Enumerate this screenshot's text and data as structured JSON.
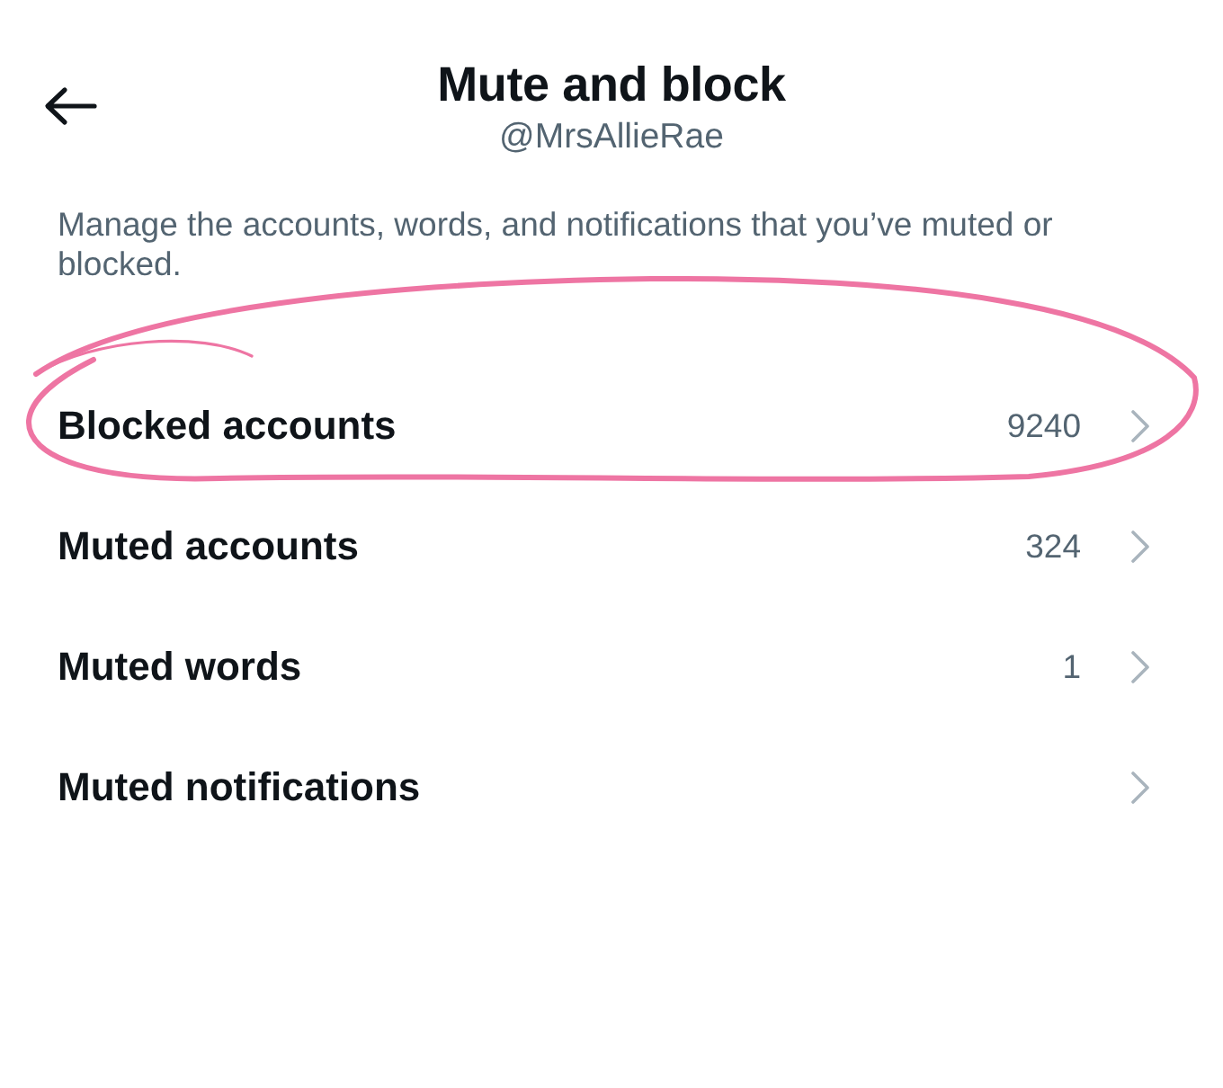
{
  "header": {
    "title": "Mute and block",
    "subtitle": "@MrsAllieRae"
  },
  "description": "Manage the accounts, words, and notifications that you’ve muted or blocked.",
  "rows": [
    {
      "label": "Blocked accounts",
      "count": "9240",
      "circled": true
    },
    {
      "label": "Muted accounts",
      "count": "324",
      "circled": false
    },
    {
      "label": "Muted words",
      "count": "1",
      "circled": false
    },
    {
      "label": "Muted notifications",
      "circled": false
    }
  ]
}
